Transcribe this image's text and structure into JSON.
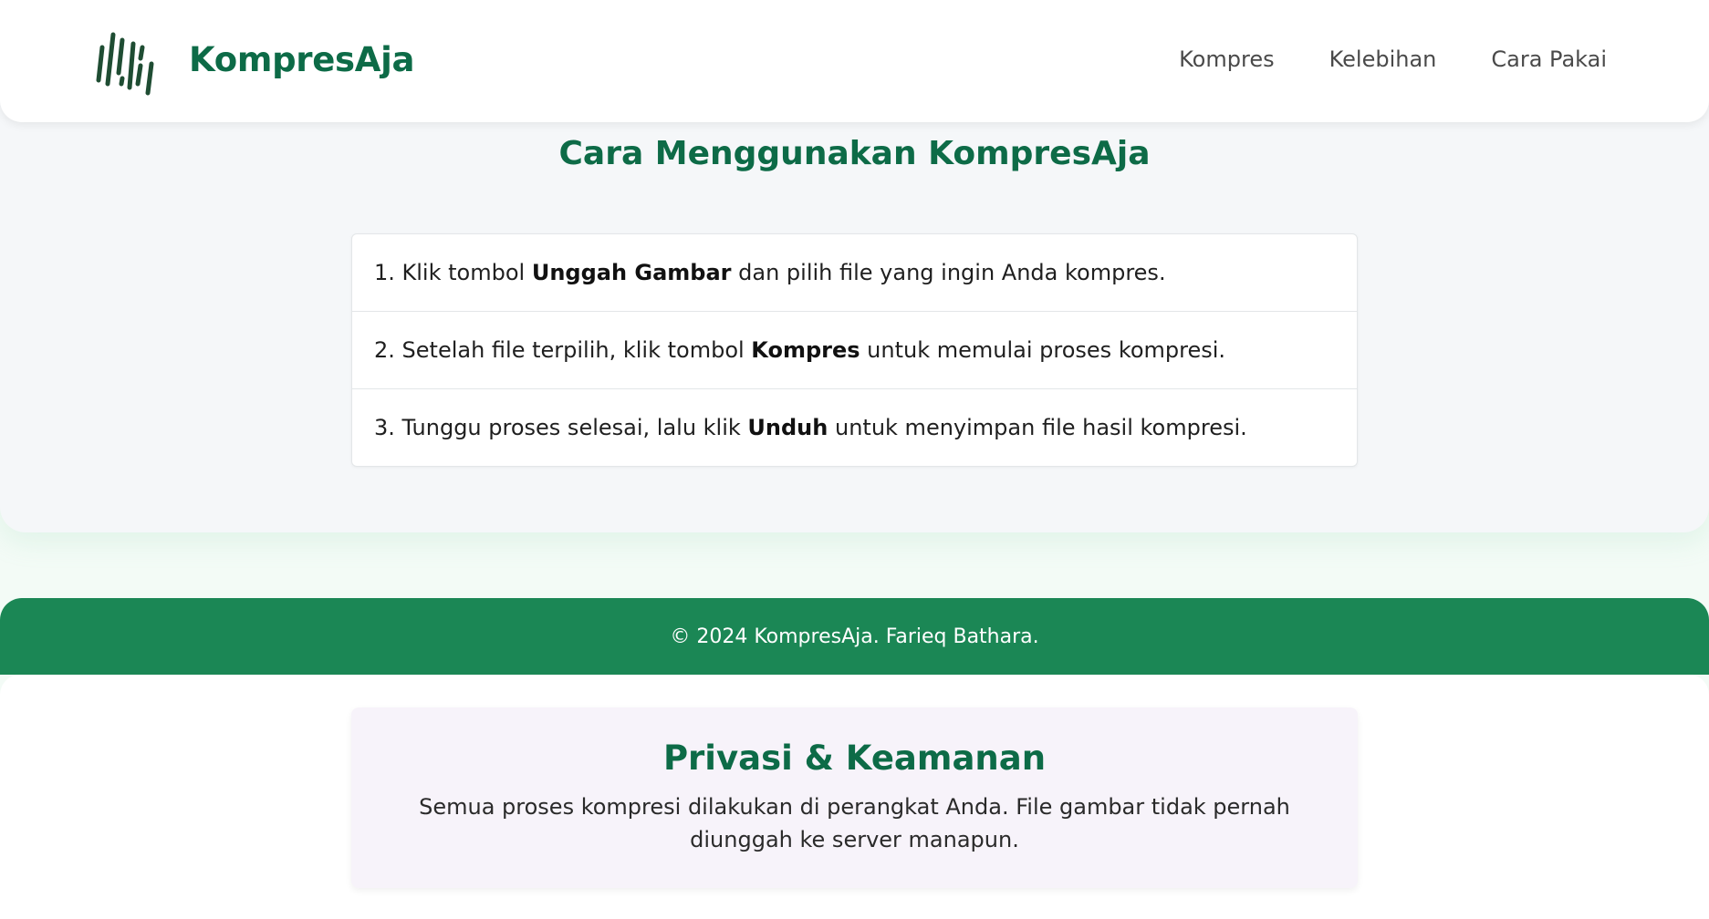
{
  "header": {
    "brand": "KompresAja",
    "logo_icon": "barcode-lines-icon",
    "nav": [
      {
        "label": "Kompres"
      },
      {
        "label": "Kelebihan"
      },
      {
        "label": "Cara Pakai"
      }
    ]
  },
  "howto": {
    "title": "Cara Menggunakan KompresAja",
    "steps": [
      {
        "prefix": "1. Klik tombol ",
        "bold": "Unggah Gambar",
        "suffix": " dan pilih file yang ingin Anda kompres."
      },
      {
        "prefix": "2. Setelah file terpilih, klik tombol ",
        "bold": "Kompres",
        "suffix": " untuk memulai proses kompresi."
      },
      {
        "prefix": "3. Tunggu proses selesai, lalu klik ",
        "bold": "Unduh",
        "suffix": " untuk menyimpan file hasil kompresi."
      }
    ]
  },
  "footer": {
    "text": "© 2024 KompresAja. Farieq Bathara."
  },
  "privacy": {
    "title": "Privasi & Keamanan",
    "text": "Semua proses kompresi dilakukan di perangkat Anda. File gambar tidak pernah diunggah ke server manapun."
  },
  "colors": {
    "brand_green": "#0d6b47",
    "footer_green": "#1b8755",
    "privacy_card_bg": "#f7f3fa"
  }
}
